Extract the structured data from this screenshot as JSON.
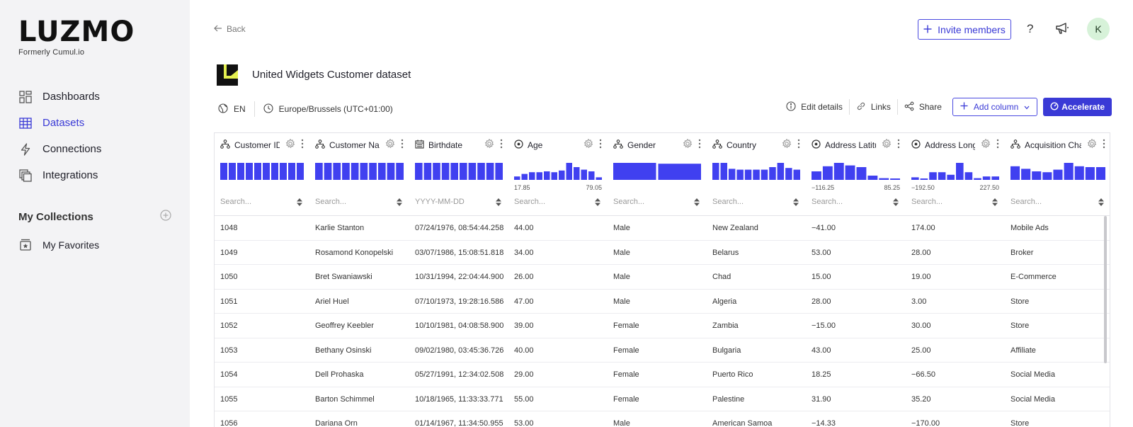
{
  "brand": {
    "name": "LUZMO",
    "subtitle": "Formerly Cumul.io"
  },
  "sidebar": {
    "items": [
      {
        "label": "Dashboards",
        "icon": "dashboard-icon",
        "active": false
      },
      {
        "label": "Datasets",
        "icon": "table-icon",
        "active": true
      },
      {
        "label": "Connections",
        "icon": "lightning-icon",
        "active": false
      },
      {
        "label": "Integrations",
        "icon": "layers-icon",
        "active": false
      }
    ],
    "collections_title": "My Collections",
    "favorites_label": "My Favorites"
  },
  "topbar": {
    "back_label": "Back",
    "invite_label": "Invite members",
    "help_label": "?",
    "avatar_initial": "K"
  },
  "dataset": {
    "title": "United Widgets Customer dataset",
    "language": "EN",
    "timezone": "Europe/Brussels (UTC+01:00)",
    "actions": {
      "edit": "Edit details",
      "links": "Links",
      "share": "Share",
      "add_column": "Add column",
      "accelerate": "Accelerate"
    }
  },
  "colors": {
    "accent": "#3a3ad6",
    "bar": "#4040f0",
    "sidebar_bg": "#f3f3f5",
    "logo_yellow": "#e4f050"
  },
  "columns": [
    {
      "name": "Customer ID",
      "type": "hierarchy",
      "placeholder": "Search...",
      "hist": [
        1,
        1,
        1,
        1,
        1,
        1,
        1,
        1,
        1,
        1
      ],
      "min": "",
      "max": ""
    },
    {
      "name": "Customer Name",
      "type": "hierarchy",
      "placeholder": "Search...",
      "hist": [
        1,
        1,
        1,
        1,
        1,
        1,
        1,
        1,
        1,
        1
      ],
      "min": "",
      "max": ""
    },
    {
      "name": "Birthdate",
      "type": "datetime",
      "placeholder": "YYYY-MM-DD",
      "hist": [
        1,
        1,
        1,
        1,
        1,
        1,
        1,
        1,
        1,
        1
      ],
      "min": "",
      "max": ""
    },
    {
      "name": "Age",
      "type": "numeric",
      "placeholder": "Search...",
      "hist": [
        0.2,
        0.35,
        0.45,
        0.45,
        0.5,
        0.45,
        0.55,
        1,
        0.75,
        0.6,
        0.5,
        0.15
      ],
      "min": "17.85",
      "max": "79.05"
    },
    {
      "name": "Gender",
      "type": "hierarchy",
      "placeholder": "Search...",
      "hist": [
        1,
        0.95
      ],
      "min": "",
      "max": ""
    },
    {
      "name": "Country",
      "type": "hierarchy",
      "placeholder": "Search...",
      "hist": [
        1,
        1,
        0.65,
        0.6,
        0.6,
        0.6,
        0.6,
        0.75,
        1,
        0.7,
        0.6
      ],
      "min": "",
      "max": ""
    },
    {
      "name": "Address Latitude",
      "type": "numeric",
      "placeholder": "Search...",
      "hist": [
        0.5,
        0.8,
        1,
        0.85,
        0.75,
        0.25,
        0.1,
        0.05
      ],
      "min": "−116.25",
      "max": "85.25"
    },
    {
      "name": "Address Longitude",
      "type": "numeric",
      "placeholder": "Search...",
      "hist": [
        0.15,
        0.05,
        0.45,
        0.45,
        0.3,
        1,
        0.45,
        0.1,
        0.2,
        0.2
      ],
      "min": "−192.50",
      "max": "227.50"
    },
    {
      "name": "Acquisition Channel",
      "type": "hierarchy",
      "placeholder": "Search...",
      "hist": [
        0.8,
        0.65,
        0.5,
        0.45,
        0.6,
        1,
        0.8,
        0.75,
        0.75
      ],
      "min": "",
      "max": ""
    }
  ],
  "rows": [
    [
      "1048",
      "Karlie Stanton",
      "07/24/1976, 08:54:44.258",
      "44.00",
      "Male",
      "New Zealand",
      "−41.00",
      "174.00",
      "Mobile Ads"
    ],
    [
      "1049",
      "Rosamond Konopelski",
      "03/07/1986, 15:08:51.818",
      "34.00",
      "Male",
      "Belarus",
      "53.00",
      "28.00",
      "Broker"
    ],
    [
      "1050",
      "Bret Swaniawski",
      "10/31/1994, 22:04:44.900",
      "26.00",
      "Male",
      "Chad",
      "15.00",
      "19.00",
      "E-Commerce"
    ],
    [
      "1051",
      "Ariel Huel",
      "07/10/1973, 19:28:16.586",
      "47.00",
      "Male",
      "Algeria",
      "28.00",
      "3.00",
      "Store"
    ],
    [
      "1052",
      "Geoffrey Keebler",
      "10/10/1981, 04:08:58.900",
      "39.00",
      "Female",
      "Zambia",
      "−15.00",
      "30.00",
      "Store"
    ],
    [
      "1053",
      "Bethany Osinski",
      "09/02/1980, 03:45:36.726",
      "40.00",
      "Female",
      "Bulgaria",
      "43.00",
      "25.00",
      "Affiliate"
    ],
    [
      "1054",
      "Dell Prohaska",
      "05/27/1991, 12:34:02.508",
      "29.00",
      "Female",
      "Puerto Rico",
      "18.25",
      "−66.50",
      "Social Media"
    ],
    [
      "1055",
      "Barton Schimmel",
      "10/18/1965, 11:33:33.771",
      "55.00",
      "Female",
      "Palestine",
      "31.90",
      "35.20",
      "Social Media"
    ],
    [
      "1056",
      "Dariana Orn",
      "01/14/1967, 11:34:50.955",
      "53.00",
      "Male",
      "American Samoa",
      "−14.33",
      "−170.00",
      "Store"
    ]
  ]
}
